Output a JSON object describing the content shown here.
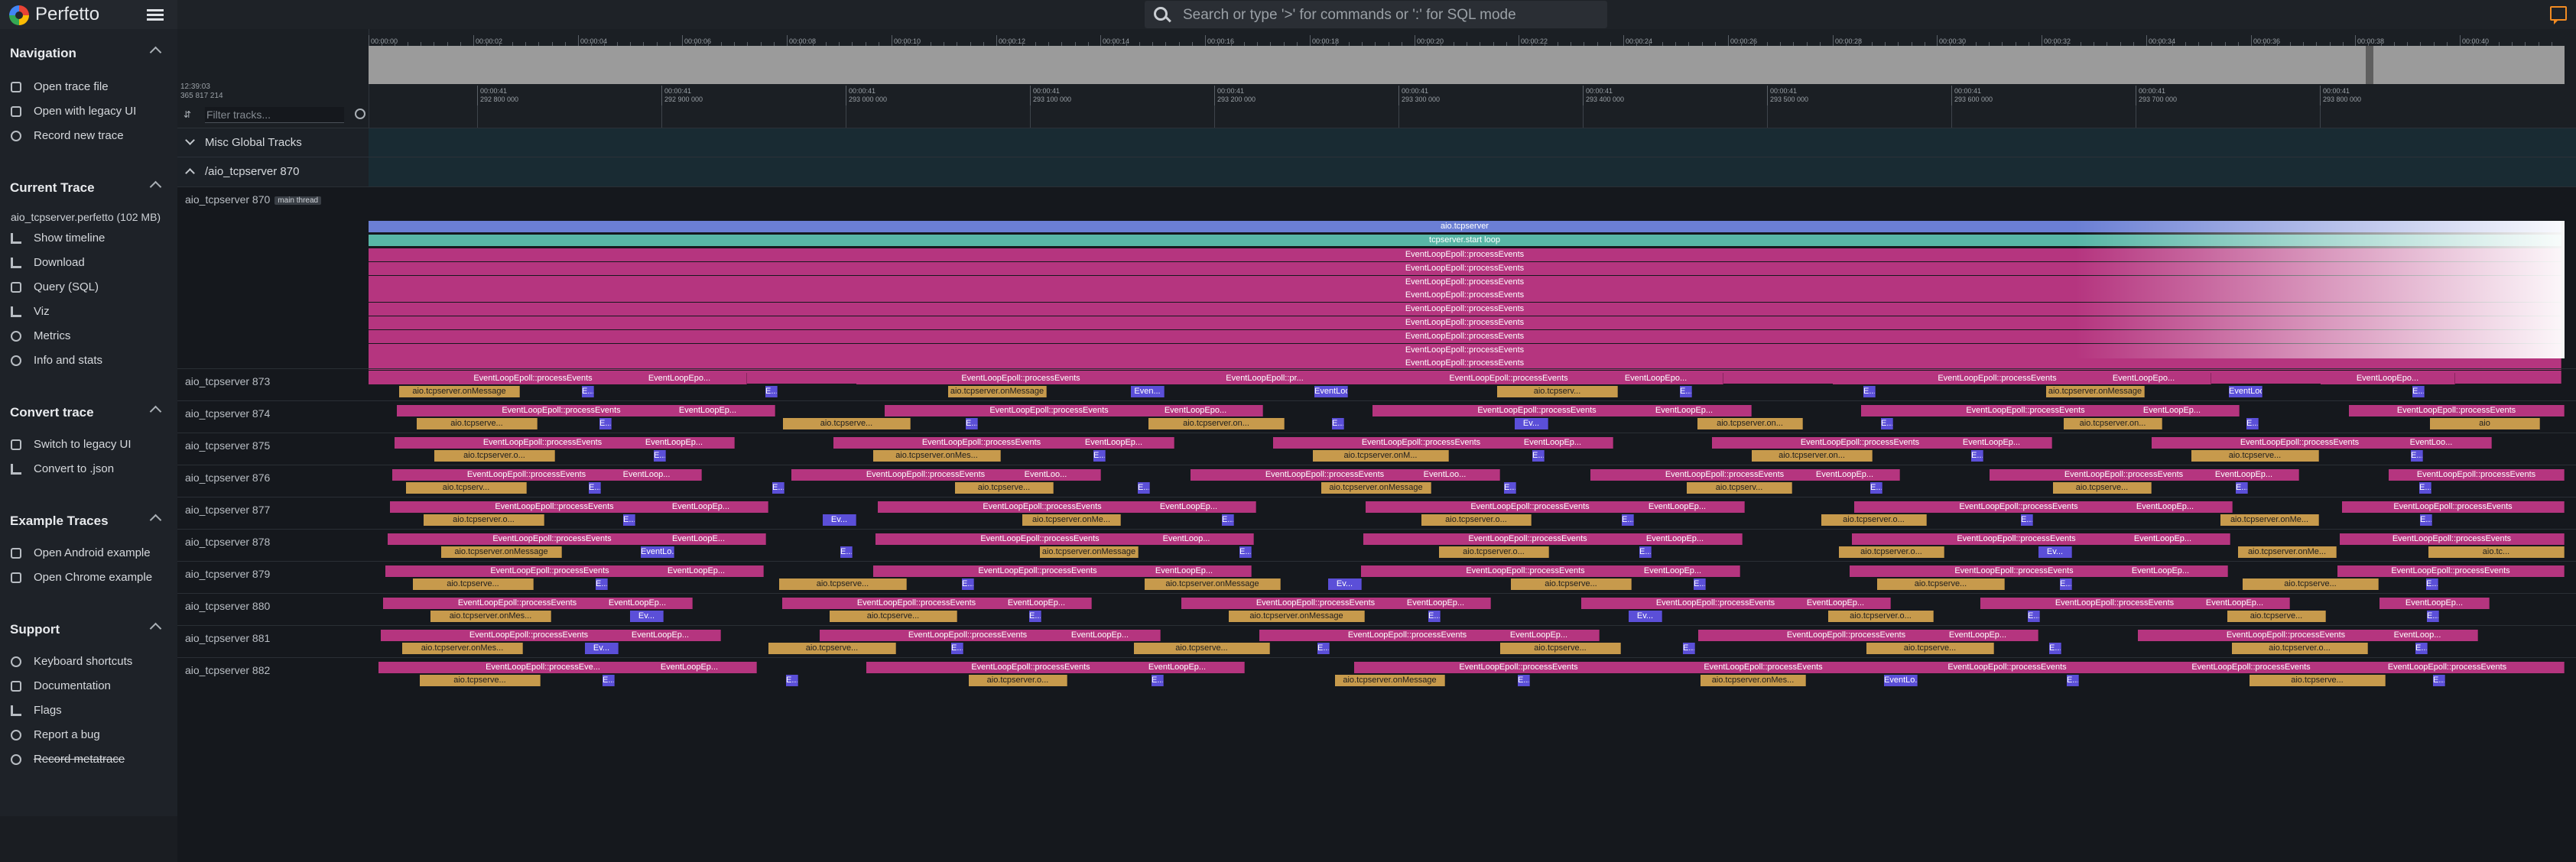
{
  "app": {
    "name": "Perfetto"
  },
  "omnibox": {
    "placeholder": "Search or type '>' for commands or ':' for SQL mode"
  },
  "sidebar": {
    "sections": [
      {
        "title": "Navigation",
        "items": [
          {
            "label": "Open trace file",
            "icon": "folder-open-icon"
          },
          {
            "label": "Open with legacy UI",
            "icon": "filter-none-icon"
          },
          {
            "label": "Record new trace",
            "icon": "fiber-smart-record-icon"
          }
        ]
      },
      {
        "title": "Current Trace",
        "file": "aio_tcpserver.perfetto (102 MB)",
        "items": [
          {
            "label": "Show timeline",
            "icon": "line-style-icon"
          },
          {
            "label": "Download",
            "icon": "file-download-icon"
          },
          {
            "label": "Query (SQL)",
            "icon": "database-icon"
          },
          {
            "label": "Viz",
            "icon": "area-chart-icon"
          },
          {
            "label": "Metrics",
            "icon": "speed-icon"
          },
          {
            "label": "Info and stats",
            "icon": "info-icon"
          }
        ]
      },
      {
        "title": "Convert trace",
        "items": [
          {
            "label": "Switch to legacy UI",
            "icon": "call-split-icon"
          },
          {
            "label": "Convert to .json",
            "icon": "file-download-icon"
          }
        ]
      },
      {
        "title": "Example Traces",
        "items": [
          {
            "label": "Open Android example",
            "icon": "description-icon"
          },
          {
            "label": "Open Chrome example",
            "icon": "description-icon"
          }
        ]
      },
      {
        "title": "Support",
        "items": [
          {
            "label": "Keyboard shortcuts",
            "icon": "help-icon"
          },
          {
            "label": "Documentation",
            "icon": "find-in-page-icon"
          },
          {
            "label": "Flags",
            "icon": "emoji-flags-icon"
          },
          {
            "label": "Report a bug",
            "icon": "bug-report-icon"
          },
          {
            "label": "Record metatrace",
            "icon": "fiber-smart-record-icon"
          }
        ]
      }
    ]
  },
  "timeline": {
    "overview_ticks": [
      "00:00:00",
      "00:00:02",
      "00:00:04",
      "00:00:06",
      "00:00:08",
      "00:00:10",
      "00:00:12",
      "00:00:14",
      "00:00:16",
      "00:00:18",
      "00:00:20",
      "00:00:22",
      "00:00:24",
      "00:00:26",
      "00:00:28",
      "00:00:30",
      "00:00:32",
      "00:00:34",
      "00:00:36",
      "00:00:38",
      "00:00:40"
    ],
    "timestamp_left": [
      "12:39:03",
      "365 817 214"
    ],
    "detail_ticks": [
      [
        "00:00:41",
        "292 800 000"
      ],
      [
        "00:00:41",
        "292 900 000"
      ],
      [
        "00:00:41",
        "293 000 000"
      ],
      [
        "00:00:41",
        "293 100 000"
      ],
      [
        "00:00:41",
        "293 200 000"
      ],
      [
        "00:00:41",
        "293 300 000"
      ],
      [
        "00:00:41",
        "293 400 000"
      ],
      [
        "00:00:41",
        "293 500 000"
      ],
      [
        "00:00:41",
        "293 600 000"
      ],
      [
        "00:00:41",
        "293 700 000"
      ],
      [
        "00:00:41",
        "293 800 000"
      ]
    ],
    "filter_placeholder": "Filter tracks..."
  },
  "groups": {
    "misc": "Misc Global Tracks",
    "process": "/aio_tcpserver 870"
  },
  "main_thread": {
    "name": "aio_tcpserver 870",
    "tag": "main thread",
    "top_slices": [
      "aio.tcpserver",
      "tcpserver.start loop"
    ],
    "repeat_label": "EventLoopEpoll::processEvents",
    "repeat_count": 10
  },
  "worker_threads": [
    {
      "name": "aio_tcpserver 873",
      "row1": [
        "EventLoopEpoll::processEvents",
        "EventLoopEpo...",
        "EventLoopEpoll::processEvents",
        "EventLoopEpoll::pr...",
        "EventLoopEpoll::processEvents",
        "EventLoopEpo...",
        "EventLoopEpoll::processEvents",
        "EventLoopEpo...",
        "EventLoopEpo..."
      ],
      "row2": [
        "aio.tcpserver.onMessage",
        "E...",
        "E...",
        "aio.tcpserver.onMessage",
        "Even...",
        "EventLoop...",
        "aio.tcpserv...",
        "E...",
        "E...",
        "aio.tcpserver.onMessage",
        "EventLoop...",
        "E..."
      ]
    },
    {
      "name": "aio_tcpserver 874",
      "row1": [
        "EventLoopEpoll::processEvents",
        "EventLoopEp...",
        "EventLoopEpoll::processEvents",
        "EventLoopEpo...",
        "EventLoopEpoll::processEvents",
        "EventLoopEp...",
        "EventLoopEpoll::processEvents",
        "EventLoopEp...",
        "EventLoopEpoll::processEvents"
      ],
      "row2": [
        "aio.tcpserve...",
        "E...",
        "aio.tcpserve...",
        "E...",
        "aio.tcpserver.on...",
        "E...",
        "Ev...",
        "aio.tcpserver.on...",
        "E...",
        "aio.tcpserver.on...",
        "E...",
        "aio"
      ]
    },
    {
      "name": "aio_tcpserver 875",
      "row1": [
        "EventLoopEpoll::processEvents",
        "EventLoopEp...",
        "EventLoopEpoll::processEvents",
        "EventLoopEp...",
        "EventLoopEpoll::processEvents",
        "EventLoopEp...",
        "EventLoopEpoll::processEvents",
        "EventLoopEp...",
        "EventLoopEpoll::processEvents",
        "EventLoo..."
      ],
      "row2": [
        "aio.tcpserver.o...",
        "E...",
        "aio.tcpserver.onMes...",
        "E...",
        "aio.tcpserver.onM...",
        "E...",
        "aio.tcpserver.on...",
        "E...",
        "aio.tcpserve...",
        "E..."
      ]
    },
    {
      "name": "aio_tcpserver 876",
      "row1": [
        "EventLoopEpoll::processEvents",
        "EventLoop...",
        "EventLoopEpoll::processEvents",
        "EventLoo...",
        "EventLoopEpoll::processEvents",
        "EventLoo...",
        "EventLoopEpoll::processEvents",
        "EventLoopEp...",
        "EventLoopEpoll::processEvents",
        "EventLoopEp...",
        "EventLoopEpoll::processEvents"
      ],
      "row2": [
        "aio.tcpserv...",
        "E...",
        "E...",
        "aio.tcpserve...",
        "E...",
        "aio.tcpserver.onMessage",
        "E...",
        "aio.tcpserv...",
        "E...",
        "aio.tcpserve...",
        "E...",
        "E..."
      ]
    },
    {
      "name": "aio_tcpserver 877",
      "row1": [
        "EventLoopEpoll::processEvents",
        "EventLoopEp...",
        "EventLoopEpoll::processEvents",
        "EventLoopEp...",
        "EventLoopEpoll::processEvents",
        "EventLoopEp...",
        "EventLoopEpoll::processEvents",
        "EventLoopEp...",
        "EventLoopEpoll::processEvents"
      ],
      "row2": [
        "aio.tcpserver.o...",
        "E...",
        "Ev...",
        "aio.tcpserver.onMe...",
        "E...",
        "aio.tcpserver.o...",
        "E...",
        "aio.tcpserver.o...",
        "E...",
        "aio.tcpserver.onMe...",
        "E..."
      ]
    },
    {
      "name": "aio_tcpserver 878",
      "row1": [
        "EventLoopEpoll::processEvents",
        "EventLoopE...",
        "EventLoopEpoll::processEvents",
        "EventLoop...",
        "EventLoopEpoll::processEvents",
        "EventLoopEp...",
        "EventLoopEpoll::processEvents",
        "EventLoopEp...",
        "EventLoopEpoll::processEvents"
      ],
      "row2": [
        "aio.tcpserver.onMessage",
        "EventLo...",
        "E...",
        "aio.tcpserver.onMessage",
        "E...",
        "aio.tcpserver.o...",
        "E...",
        "aio.tcpserver.o...",
        "Ev...",
        "aio.tcpserver.onMe...",
        "aio.tc..."
      ]
    },
    {
      "name": "aio_tcpserver 879",
      "row1": [
        "EventLoopEpoll::processEvents",
        "EventLoopEp...",
        "EventLoopEpoll::processEvents",
        "EventLoopEp...",
        "EventLoopEpoll::processEvents",
        "EventLoopEp...",
        "EventLoopEpoll::processEvents",
        "EventLoopEp...",
        "EventLoopEpoll::processEvents"
      ],
      "row2": [
        "aio.tcpserve...",
        "E...",
        "aio.tcpserve...",
        "E...",
        "aio.tcpserver.onMessage",
        "Ev...",
        "aio.tcpserve...",
        "E...",
        "aio.tcpserve...",
        "E...",
        "aio.tcpserve...",
        "E..."
      ]
    },
    {
      "name": "aio_tcpserver 880",
      "row1": [
        "EventLoopEpoll::processEvents",
        "EventLoopEp...",
        "EventLoopEpoll::processEvents",
        "EventLoopEp...",
        "EventLoopEpoll::processEvents",
        "EventLoopEp...",
        "EventLoopEpoll::processEvents",
        "EventLoopEp...",
        "EventLoopEpoll::processEvents",
        "EventLoopEp...",
        "EventLoopEp..."
      ],
      "row2": [
        "aio.tcpserver.onMes...",
        "Ev...",
        "aio.tcpserve...",
        "E...",
        "aio.tcpserver.onMessage",
        "E...",
        "Ev...",
        "aio.tcpserver.o...",
        "E...",
        "aio.tcpserve...",
        "E..."
      ]
    },
    {
      "name": "aio_tcpserver 881",
      "row1": [
        "EventLoopEpoll::processEvents",
        "EventLoopEp...",
        "EventLoopEpoll::processEvents",
        "EventLoopEp...",
        "EventLoopEpoll::processEvents",
        "EventLoopEp...",
        "EventLoopEpoll::processEvents",
        "EventLoopEp...",
        "EventLoopEpoll::processEvents",
        "EventLoop..."
      ],
      "row2": [
        "aio.tcpserver.onMes...",
        "Ev...",
        "aio.tcpserve...",
        "E...",
        "aio.tcpserve...",
        "E...",
        "aio.tcpserve...",
        "E...",
        "aio.tcpserve...",
        "E...",
        "aio.tcpserver.o...",
        "E..."
      ]
    },
    {
      "name": "aio_tcpserver 882",
      "row1": [
        "EventLoopEpoll::processEve...",
        "EventLoopEp...",
        "EventLoopEpoll::processEvents",
        "EventLoopEp...",
        "EventLoopEpoll::processEvents",
        "EventLoopEpoll::processEvents",
        "EventLoopEpoll::processEvents",
        "EventLoopEpoll::processEvents",
        "EventLoopEpoll::processEvents"
      ],
      "row2": [
        "aio.tcpserve...",
        "E...",
        "E...",
        "aio.tcpserver.o...",
        "E...",
        "aio.tcpserver.onMessage",
        "E...",
        "aio.tcpserver.onMes...",
        "EventLo...",
        "E...",
        "aio.tcpserve...",
        "E..."
      ]
    }
  ],
  "colors": {
    "slice_pink": "#b5357f",
    "slice_gold": "#c79a4c",
    "slice_blue": "#5b4fd8",
    "slice_slate": "#6b7fd4",
    "slice_teal": "#58b6a6",
    "accent_orange": "#f28b22"
  }
}
